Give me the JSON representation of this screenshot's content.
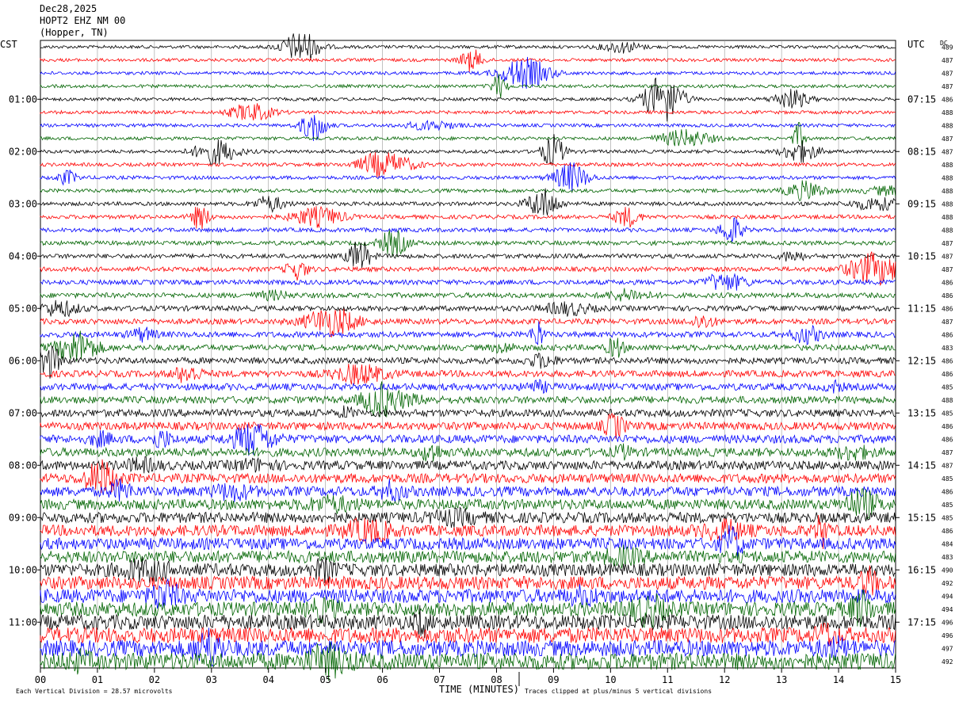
{
  "header": {
    "date": "Dec28,2025",
    "station": "HOPT2 EHZ NM 00",
    "location": "(Hopper, TN)"
  },
  "chart_data": {
    "type": "line",
    "title": "",
    "xlabel": "TIME (MINUTES)",
    "left_axis_title": "CST",
    "right_axis_title": "UTC",
    "dc_label": "DC",
    "xlim": [
      0,
      15
    ],
    "x_ticks": [
      "00",
      "01",
      "02",
      "03",
      "04",
      "05",
      "06",
      "07",
      "08",
      "09",
      "10",
      "11",
      "12",
      "13",
      "14",
      "15"
    ],
    "left_hour_labels": [
      "01:00",
      "02:00",
      "03:00",
      "04:00",
      "05:00",
      "06:00",
      "07:00",
      "08:00",
      "09:00",
      "10:00",
      "11:00"
    ],
    "right_hour_labels": [
      "07:15",
      "08:15",
      "09:15",
      "10:15",
      "11:15",
      "12:15",
      "13:15",
      "14:15",
      "15:15",
      "16:15",
      "17:15"
    ],
    "trace_colors": [
      "#000000",
      "#ff0000",
      "#0000ff",
      "#006400"
    ],
    "dc_values": [
      489,
      487,
      487,
      487,
      486,
      488,
      488,
      487,
      487,
      488,
      488,
      488,
      488,
      488,
      488,
      487,
      487,
      487,
      486,
      486,
      486,
      487,
      486,
      483,
      486,
      486,
      485,
      488,
      485,
      486,
      486,
      487,
      487,
      485,
      486,
      485,
      485,
      486,
      484,
      483,
      490,
      492,
      494,
      494,
      496,
      496,
      497,
      492
    ],
    "footer_left": "Each Vertical Division = 28.57 microvolts",
    "footer_right": "Traces clipped at plus/minus 5 vertical divisions"
  }
}
